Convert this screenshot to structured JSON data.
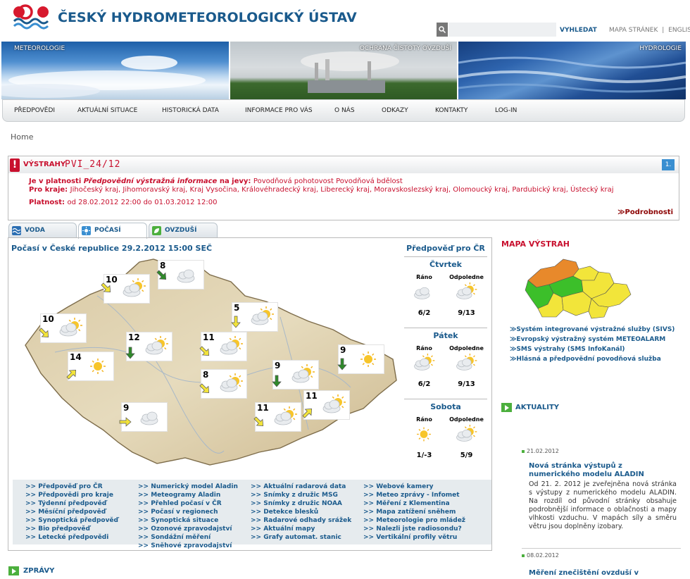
{
  "header": {
    "title": "ČESKÝ HYDROMETEOROLOGICKÝ ÚSTAV",
    "search_placeholder": "",
    "search_button": "VYHLEDAT",
    "sitemap": "MAPA STRÁNEK",
    "sep": "|",
    "english": "ENGLISH"
  },
  "banners": [
    "METEOROLOGIE",
    "OCHRANA ČISTOTY OVZDUŠÍ",
    "HYDROLOGIE"
  ],
  "nav": [
    "PŘEDPOVĚDI",
    "AKTUÁLNÍ SITUACE",
    "HISTORICKÁ DATA",
    "INFORMACE PRO VÁS",
    "O NÁS",
    "ODKAZY",
    "KONTAKTY",
    "LOG-IN"
  ],
  "breadcrumb": "Home",
  "warning": {
    "label": "VÝSTRAHY",
    "code": "PVI_24/12",
    "badge": "1.",
    "line1_pre": "Je v platnosti ",
    "line1_em": "Předpovědní výstražná informace",
    "line1_mid": " na jevy: ",
    "line1_val": "Povodňová pohotovost Povodňová bdělost",
    "regions_label": "Pro kraje: ",
    "regions": "Jihočeský kraj, Jihomoravský kraj, Kraj Vysočina, Královéhradecký kraj, Liberecký kraj, Moravskoslezský kraj, Olomoucký kraj, Pardubický kraj, Ústecký kraj",
    "validity_label": "Platnost: ",
    "validity": "od 28.02.2012 22:00 do 01.03.2012 12:00",
    "more": "≫Podrobnosti"
  },
  "tabs": [
    "VODA",
    "POČASÍ",
    "OVZDUŠÍ"
  ],
  "weather": {
    "title": "Počasí v České republice 29.2.2012 15:00 SEČ",
    "stations": [
      {
        "temp": "10",
        "sky": "sun-cloud",
        "wind": "yellow-se"
      },
      {
        "temp": "8",
        "sky": "cloud",
        "wind": "green-se"
      },
      {
        "temp": "5",
        "sky": "sun-cloud",
        "wind": "yellow-s"
      },
      {
        "temp": "10",
        "sky": "sun-cloud",
        "wind": "yellow-se"
      },
      {
        "temp": "12",
        "sky": "sun-cloud",
        "wind": "green-s"
      },
      {
        "temp": "11",
        "sky": "sun-cloud",
        "wind": "yellow-se"
      },
      {
        "temp": "14",
        "sky": "sun",
        "wind": "yellow-ne"
      },
      {
        "temp": "8",
        "sky": "sun-cloud",
        "wind": "yellow-se"
      },
      {
        "temp": "9",
        "sky": "sun-cloud",
        "wind": "green-s"
      },
      {
        "temp": "9",
        "sky": "sun",
        "wind": "green-s"
      },
      {
        "temp": "9",
        "sky": "cloud",
        "wind": "yellow-e"
      },
      {
        "temp": "11",
        "sky": "sun-cloud",
        "wind": "yellow-se"
      },
      {
        "temp": "11",
        "sky": "sun-cloud",
        "wind": "yellow-ne"
      }
    ]
  },
  "forecast": {
    "title": "Předpověď pro ČR",
    "days": [
      {
        "name": "Čtvrtek",
        "morning": "Ráno",
        "afternoon": "Odpoledne",
        "t_morning": "6/2",
        "t_afternoon": "9/13",
        "sky_m": "cloud",
        "sky_a": "sun-cloud"
      },
      {
        "name": "Pátek",
        "morning": "Ráno",
        "afternoon": "Odpoledne",
        "t_morning": "6/2",
        "t_afternoon": "9/13",
        "sky_m": "sun-cloud",
        "sky_a": "sun-cloud"
      },
      {
        "name": "Sobota",
        "morning": "Ráno",
        "afternoon": "Odpoledne",
        "t_morning": "1/-3",
        "t_afternoon": "5/9",
        "sky_m": "sun",
        "sky_a": "sun-cloud"
      }
    ]
  },
  "links": [
    [
      ">> Předpověď pro ČR",
      ">> Předpovědi pro kraje",
      ">> Týdenní předpověď",
      ">> Měsíční předpověď",
      ">> Synoptická předpověď",
      ">> Bio předpověď",
      ">> Letecké předpovědi"
    ],
    [
      ">> Numerický model Aladin",
      ">> Meteogramy Aladin",
      ">> Přehled počasí v ČR",
      ">> Počasí v regionech",
      ">> Synoptická situace",
      ">> Ozonové zpravodajství",
      ">> Sondážní měření",
      ">> Sněhové zpravodajství"
    ],
    [
      ">> Aktuální radarová data",
      ">> Snímky z družic MSG",
      ">> Snímky z družic NOAA",
      ">> Detekce blesků",
      ">> Radarové odhady srážek",
      ">> Aktuální mapy",
      ">> Grafy automat. stanic"
    ],
    [
      ">> Webové kamery",
      ">> Meteo zprávy - Infomet",
      ">> Měření z Klementina",
      ">> Mapa zatížení sněhem",
      ">> Meteorologie pro mládež",
      ">> Nalezli jste radiosondu?",
      ">> Vertikální profily větru"
    ]
  ],
  "warnmap": {
    "title": "MAPA VÝSTRAH",
    "links": [
      "≫Systém integrované výstražné služby (SIVS)",
      "≫Evropský výstražný systém METEOALARM",
      "≫SMS výstrahy (SMS InfoKanál)",
      "≫Hlásná a předpovědní povodňová služba"
    ],
    "colors": {
      "orange": "#e8892b",
      "yellow": "#f2e53a",
      "green": "#3cbf2a"
    }
  },
  "news": {
    "title": "AKTUALITY",
    "items": [
      {
        "date": "21.02.2012",
        "head1": "Nová stránka výstupů z",
        "head2": "numerického modelu ALADIN",
        "text": "Od 21. 2. 2012 je zveřejněna nová stránka s výstupy z numerického modelu ALADIN. Na rozdíl od původní stránky obsahuje podrobnější informace o oblačnosti a mapy vlhkosti vzduchu. V mapách síly a směru větru jsou doplněny izobary."
      },
      {
        "date": "08.02.2012",
        "head1": "Měření znečištění ovzduší v",
        "head2": "",
        "text": ""
      }
    ]
  },
  "bottom": {
    "zpravy": "ZPRÁVY"
  }
}
